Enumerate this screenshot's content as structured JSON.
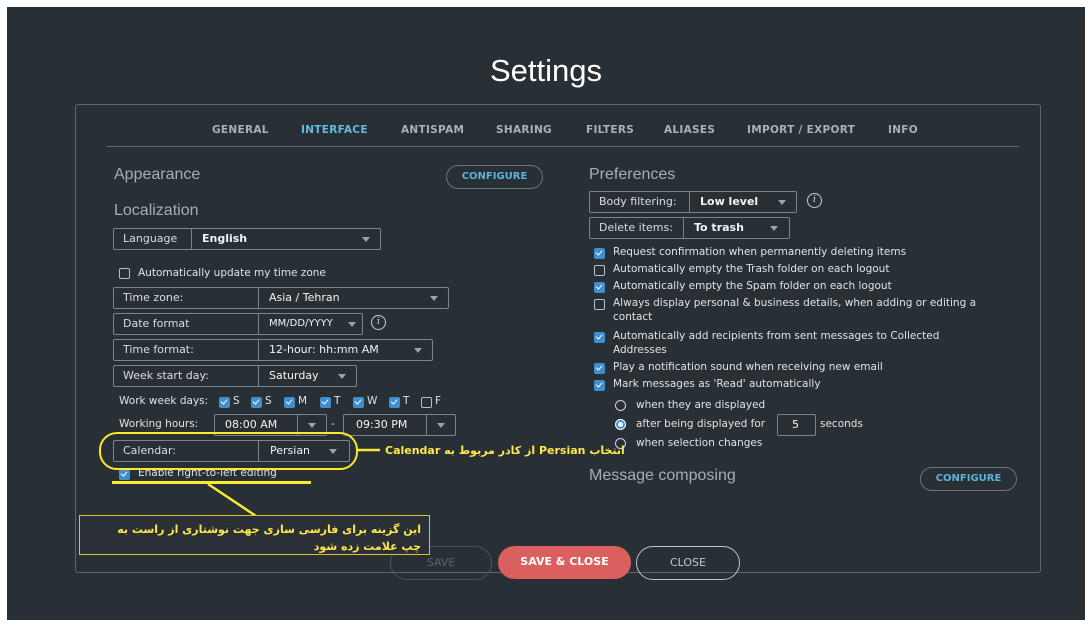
{
  "page": {
    "title": "Settings"
  },
  "tabs": [
    {
      "label": "GENERAL"
    },
    {
      "label": "INTERFACE"
    },
    {
      "label": "ANTISPAM"
    },
    {
      "label": "SHARING"
    },
    {
      "label": "FILTERS"
    },
    {
      "label": "ALIASES"
    },
    {
      "label": "IMPORT / EXPORT"
    },
    {
      "label": "INFO"
    }
  ],
  "appearance": {
    "title": "Appearance",
    "configure_label": "CONFIGURE"
  },
  "localization": {
    "title": "Localization",
    "language": {
      "label": "Language",
      "value": "English"
    },
    "auto_timezone": {
      "label": "Automatically update my time zone",
      "checked": false
    },
    "time_zone": {
      "label": "Time zone:",
      "value": "Asia / Tehran"
    },
    "date_format": {
      "label": "Date format",
      "value": "MM/DD/YYYY"
    },
    "time_format": {
      "label": "Time format:",
      "value": "12-hour: hh:mm AM"
    },
    "week_start": {
      "label": "Week start day:",
      "value": "Saturday"
    },
    "work_week": {
      "label": "Work week days:",
      "days": [
        {
          "label": "S",
          "checked": true
        },
        {
          "label": "S",
          "checked": true
        },
        {
          "label": "M",
          "checked": true
        },
        {
          "label": "T",
          "checked": true
        },
        {
          "label": "W",
          "checked": true
        },
        {
          "label": "T",
          "checked": true
        },
        {
          "label": "F",
          "checked": false
        }
      ]
    },
    "working_hours": {
      "label": "Working hours:",
      "from": "08:00 AM",
      "separator": "-",
      "to": "09:30 PM"
    },
    "calendar": {
      "label": "Calendar:",
      "value": "Persian"
    },
    "rtl_editing": {
      "label": "Enable right-to-left editing",
      "checked": true
    }
  },
  "preferences": {
    "title": "Preferences",
    "body_filtering": {
      "label": "Body filtering:",
      "value": "Low level"
    },
    "delete_items": {
      "label": "Delete items:",
      "value": "To trash"
    },
    "options": [
      {
        "label": "Request confirmation when permanently deleting items",
        "checked": true
      },
      {
        "label": "Automatically empty the Trash folder on each logout",
        "checked": false
      },
      {
        "label": "Automatically empty the Spam folder on each logout",
        "checked": true
      },
      {
        "label": "Always display personal & business details, when adding or editing a",
        "label2": "contact",
        "checked": false
      },
      {
        "label": "Automatically add recipients from sent messages to Collected",
        "label2": "Addresses",
        "checked": true
      },
      {
        "label": "Play a notification sound when receiving new email",
        "checked": true
      },
      {
        "label": "Mark messages as 'Read' automatically",
        "checked": true
      }
    ],
    "read_modes": [
      {
        "label": "when they are displayed",
        "selected": false
      },
      {
        "label": "after being displayed for",
        "selected": true,
        "value": "5",
        "suffix": "seconds"
      },
      {
        "label": "when selection changes",
        "selected": false
      }
    ]
  },
  "message_composing": {
    "title": "Message composing",
    "configure_label": "CONFIGURE"
  },
  "footer": {
    "save_label": "SAVE",
    "save_close_label": "SAVE & CLOSE",
    "close_label": "CLOSE"
  },
  "annotations": {
    "calendar_note": "انتخاب Persian از کادر مربوط به Calendar",
    "rtl_note_line1": "این گزینه برای فارسی سازی جهت نوشتاری از راست به",
    "rtl_note_line2": "چپ علامت زده شود",
    "highlight_color": "#f7ea2f"
  },
  "colors": {
    "accent": "#5ab3dc",
    "primary_button": "#d9605e",
    "background": "#283036"
  }
}
